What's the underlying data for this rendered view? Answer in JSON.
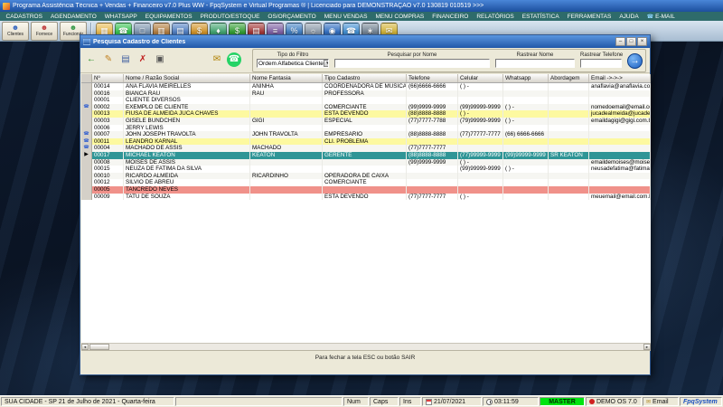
{
  "window": {
    "title": "Programa Assistência Técnica + Vendas + Financeiro v7.0 Plus WW - FpqSystem e Virtual Programas ® | Licenciado para  DEMONSTRAÇÃO v7.0 130819 010519 >>>",
    "menu_items": [
      {
        "label": "CADASTROS"
      },
      {
        "label": "AGENDAMENTO"
      },
      {
        "label": "WHATSAPP"
      },
      {
        "label": "EQUIPAMENTOS"
      },
      {
        "label": "PRODUTO/ESTOQUE"
      },
      {
        "label": "OS/ORÇAMENTO"
      },
      {
        "label": "MENU VENDAS"
      },
      {
        "label": "MENU COMPRAS"
      },
      {
        "label": "FINANCEIRO"
      },
      {
        "label": "RELATÓRIOS"
      },
      {
        "label": "ESTATÍSTICA"
      },
      {
        "label": "FERRAMENTAS"
      },
      {
        "label": "AJUDA"
      },
      {
        "label": "E-MAIL",
        "icon": "phone-icon"
      }
    ],
    "toolbar": {
      "buttons": [
        {
          "label": "Clientes",
          "color": "#3a6ac0",
          "icon": "clients-person-icon"
        },
        {
          "label": "Fornece",
          "color": "#c04040",
          "icon": "suppliers-person-icon"
        },
        {
          "label": "Funcionár",
          "color": "#3a9a4a",
          "icon": "employees-person-icon"
        }
      ],
      "icons": [
        {
          "name": "calendar-agenda-icon",
          "glyph": "▦",
          "color": "#e8b84a"
        },
        {
          "name": "whatsapp-icon",
          "glyph": "☎",
          "color": "#2fbf4a"
        },
        {
          "name": "equipment-icon",
          "glyph": "□",
          "color": "#7a92ad"
        },
        {
          "name": "stock-box-icon",
          "glyph": "▥",
          "color": "#b07a3a"
        },
        {
          "name": "os-document-icon",
          "glyph": "▤",
          "color": "#4a7ac0"
        },
        {
          "name": "sales-cart-icon",
          "glyph": "$",
          "color": "#d09020"
        },
        {
          "name": "purchases-cart-icon",
          "glyph": "♦",
          "color": "#3aa06a"
        },
        {
          "name": "finance-dollar-icon",
          "glyph": "$",
          "color": "#2a9a2a"
        },
        {
          "name": "notebook-icon",
          "glyph": "▤",
          "color": "#a03030"
        },
        {
          "name": "reports-icon",
          "glyph": "≡",
          "color": "#7a5aa0"
        },
        {
          "name": "statistics-icon",
          "glyph": "%",
          "color": "#3a7ac0"
        },
        {
          "name": "satellite-icon",
          "glyph": "☼",
          "color": "#8a98a8"
        },
        {
          "name": "globe-icon",
          "glyph": "◉",
          "color": "#2a6ac0"
        },
        {
          "name": "phone-icon",
          "glyph": "☎",
          "color": "#3a8ad0"
        },
        {
          "name": "settings-icon",
          "glyph": "∗",
          "color": "#708090"
        },
        {
          "name": "mail-icon",
          "glyph": "✉",
          "color": "#d0b030"
        }
      ]
    }
  },
  "dialog": {
    "title": "Pesquisa Cadastro de Clientes",
    "window_buttons": [
      {
        "name": "minimize-button",
        "glyph": "–"
      },
      {
        "name": "maximize-button",
        "glyph": "□"
      },
      {
        "name": "close-button",
        "glyph": "×"
      }
    ],
    "toolbar_icons": [
      {
        "name": "exit-button",
        "glyph": "←",
        "fg": "#1a8a1a"
      },
      {
        "name": "new-record-button",
        "glyph": "✎",
        "fg": "#c08020"
      },
      {
        "name": "edit-record-button",
        "glyph": "▤",
        "fg": "#4060a0"
      },
      {
        "name": "delete-record-button",
        "glyph": "✗",
        "fg": "#c02020"
      },
      {
        "name": "print-button",
        "glyph": "▣",
        "fg": "#555555"
      },
      {
        "name": "email-button",
        "glyph": "✉",
        "fg": "#b08000",
        "gap": 44
      },
      {
        "name": "whatsapp-button",
        "glyph": "☎",
        "bg": "#25d366",
        "fg": "#ffffff",
        "round": true
      }
    ],
    "filters": {
      "tipo_label": "Tipo do Filtro",
      "tipo_value": "Ordem Alfabetica Cliente",
      "pesquisar_label": "Pesquisar por Nome",
      "rastrear_nome_label": "Rastrear Nome",
      "rastrear_tel_label": "Rastrear Telefone"
    },
    "grid": {
      "columns": [
        "Nº",
        "Nome / Razão Social",
        "Nome Fantasia",
        "Tipo Cadastro",
        "Telefone",
        "Celular",
        "Whatsapp",
        "Abordagem",
        "Email ->->->"
      ],
      "rows": [
        {
          "c": [
            "00014",
            "ANA FLAVIA MEIRELLES",
            "ANINHA",
            "COORDENADORA DE MUSICA",
            "(66)6666-6666",
            "( )  -",
            "",
            "",
            "anaflavia@anaflavia.com.br"
          ],
          "hl": "none",
          "marker": false
        },
        {
          "c": [
            "00016",
            "BIANCA RAU",
            "RAU",
            "PROFESSORA",
            "",
            "",
            "",
            "",
            ""
          ],
          "hl": "none",
          "marker": false
        },
        {
          "c": [
            "00001",
            "CLIENTE DIVERSOS",
            "",
            "",
            "",
            "",
            "",
            "",
            ""
          ],
          "hl": "none",
          "marker": false
        },
        {
          "c": [
            "00002",
            "EXEMPLO DE CLIENTE",
            "",
            "COMERCIANTE",
            "(99)9999-9999",
            "(99)99999-9999",
            "( )  -",
            "",
            "nomedoemail@email.com.br"
          ],
          "hl": "none",
          "marker": true
        },
        {
          "c": [
            "00013",
            "FIUSA DE ALMEIDA JUCA CHAVES",
            "",
            "ESTA DEVENDO",
            "(88)8888-8888",
            "( )  -",
            "",
            "",
            "jucadealmeida@jucadealmeida.co"
          ],
          "hl": "yellow",
          "marker": false
        },
        {
          "c": [
            "00003",
            "GISELE BUNDCHEN",
            "GIGI",
            "ESPECIAL",
            "(77)7777-7788",
            "(79)99999-9999",
            "( )  -",
            "",
            "emaildagigi@gigi.com.br"
          ],
          "hl": "none",
          "marker": false
        },
        {
          "c": [
            "00006",
            "JERRY LEWIS",
            "",
            "",
            "",
            "",
            "",
            "",
            ""
          ],
          "hl": "none",
          "marker": false
        },
        {
          "c": [
            "00007",
            "JOHN JOSEPH TRAVOLTA",
            "JOHN TRAVOLTA",
            "EMPRESARIO",
            "(88)8888-8888",
            "(77)77777-7777",
            "(66) 6666-6666",
            "",
            ""
          ],
          "hl": "none",
          "marker": true
        },
        {
          "c": [
            "00011",
            "LEANDRO KARNAL",
            "",
            "CLI. PROBLEMA",
            "",
            "",
            "",
            "",
            ""
          ],
          "hl": "yellow",
          "marker": true
        },
        {
          "c": [
            "00004",
            "MACHADO DE ASSIS",
            "MACHADO",
            "",
            "(77)7777-7777",
            "",
            "",
            "",
            ""
          ],
          "hl": "none",
          "marker": true
        },
        {
          "c": [
            "00017",
            "MICHAEL KEATON",
            "KEATON",
            "GERENTE",
            "(88)8888-8888",
            "(77)99999-9999",
            "(99)99999-9999",
            "SR KEATON",
            ""
          ],
          "hl": "selected",
          "marker": false
        },
        {
          "c": [
            "00008",
            "MOISES DE ASSIS",
            "",
            "",
            "(99)9999-9999",
            "( )  -",
            "",
            "",
            "emaildemoises@moises.com.br"
          ],
          "hl": "none",
          "marker": false
        },
        {
          "c": [
            "00015",
            "NEUZA DE FATIMA DA SILVA",
            "",
            "",
            "",
            "(99)99999-9999",
            "( )  -",
            "",
            "neusadefatima@fatima.com.br"
          ],
          "hl": "none",
          "marker": false
        },
        {
          "c": [
            "00010",
            "RICARDO ALMEIDA",
            "RICARDINHO",
            "OPERADORA DE CAIXA",
            "",
            "",
            "",
            "",
            ""
          ],
          "hl": "none",
          "marker": false
        },
        {
          "c": [
            "00012",
            "SILVIO DE ABREU",
            "",
            "COMERCIANTE",
            "",
            "",
            "",
            "",
            ""
          ],
          "hl": "none",
          "marker": false
        },
        {
          "c": [
            "00005",
            "TANCREDO NEVES",
            "",
            "",
            "",
            "",
            "",
            "",
            ""
          ],
          "hl": "red",
          "marker": false
        },
        {
          "c": [
            "00009",
            "TATU DE SOUZA",
            "",
            "ESTA DEVENDO",
            "(77)7777-7777",
            "( )  -",
            "",
            "",
            "meuemail@email.com.b"
          ],
          "hl": "none",
          "marker": false
        }
      ]
    },
    "footer": "Para fechar a tela ESC ou botão SAIR"
  },
  "statusbar": {
    "location": "SUA CIDADE - SP 21 de Julho de 2021 - Quarta-feira",
    "num": "Num",
    "caps": "Caps",
    "ins": "Ins",
    "date": "21/07/2021",
    "time": "03:11:59",
    "master": "MASTER",
    "demo": "DEMO OS 7.0",
    "email": "Email",
    "brand": "FpqSystem"
  },
  "icons": {
    "person": "☻",
    "chevron_down": "▼",
    "arrow_right": "→",
    "row_marker": "▶",
    "phone_marker": "☎",
    "envelope": "✉",
    "scroll_left": "◄",
    "scroll_right": "►"
  },
  "colors": {
    "row_yellow": "#fdf9a0",
    "row_red": "#f0918a",
    "row_selected": "#2f9596",
    "master_green": "#00e410",
    "menubar_teal": "#2e6b6b",
    "whatsapp_green": "#25d366"
  }
}
